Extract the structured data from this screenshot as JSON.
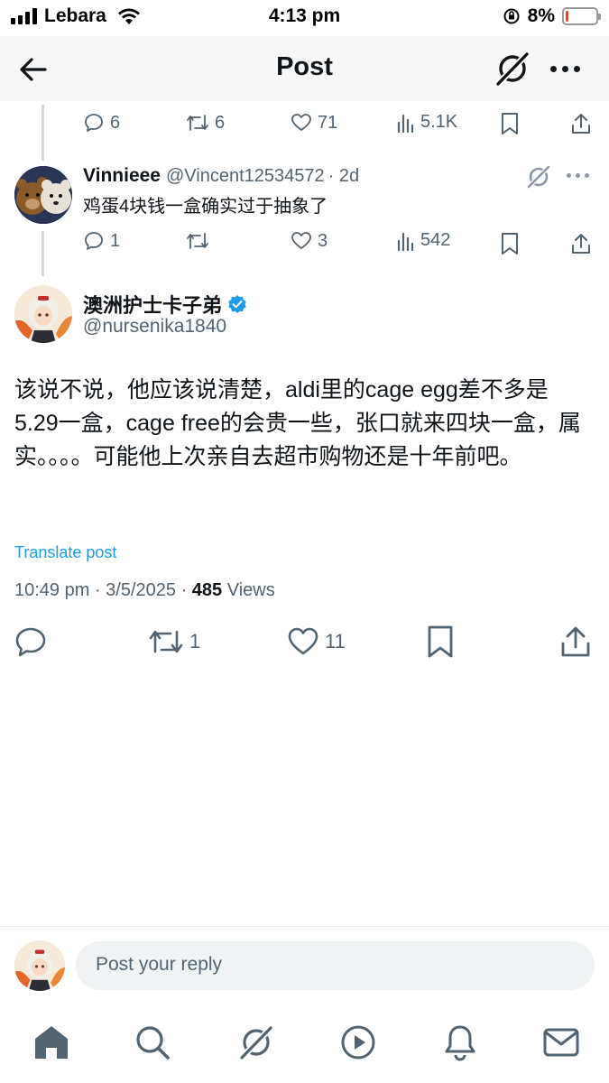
{
  "status_bar": {
    "carrier": "Lebara",
    "time": "4:13 pm",
    "battery_percent": "8%",
    "battery_level": 0.08,
    "battery_color": "#ff3b30"
  },
  "header": {
    "title": "Post",
    "back_icon": "arrow-left-icon",
    "grok_icon": "grok-icon",
    "more_icon": "more-horizontal-icon"
  },
  "parent_tweet_actions": {
    "replies": "6",
    "retweets": "6",
    "likes": "71",
    "views": "5.1K"
  },
  "reply": {
    "display_name": "Vinnieee",
    "handle": "@Vincent12534572",
    "time": "· 2d",
    "text": "鸡蛋4块钱一盒确实过于抽象了",
    "actions": {
      "replies": "1",
      "retweets": "",
      "likes": "3",
      "views": "542"
    }
  },
  "main_post": {
    "display_name": "澳洲护士卡子弟",
    "handle": "@nursenika1840",
    "verified": true,
    "body": "该说不说，他应该说清楚，aldi里的cage egg差不多是5.29一盒，cage free的会贵一些，张口就来四块一盒，属实。。。。可能他上次亲自去超市购物还是十年前吧。",
    "translate_label": "Translate post",
    "timestamp": "10:49 pm · 3/5/2025 · ",
    "views_count": "485",
    "views_label": " Views",
    "actions": {
      "replies": "",
      "retweets": "1",
      "likes": "11"
    }
  },
  "composer": {
    "placeholder": "Post your reply"
  },
  "tabbar": {
    "items": [
      "home-icon",
      "search-icon",
      "grok-icon",
      "video-icon",
      "notifications-icon",
      "messages-icon"
    ]
  },
  "colors": {
    "accent": "#1d9bf0",
    "muted": "#536471",
    "text": "#0f1419"
  }
}
